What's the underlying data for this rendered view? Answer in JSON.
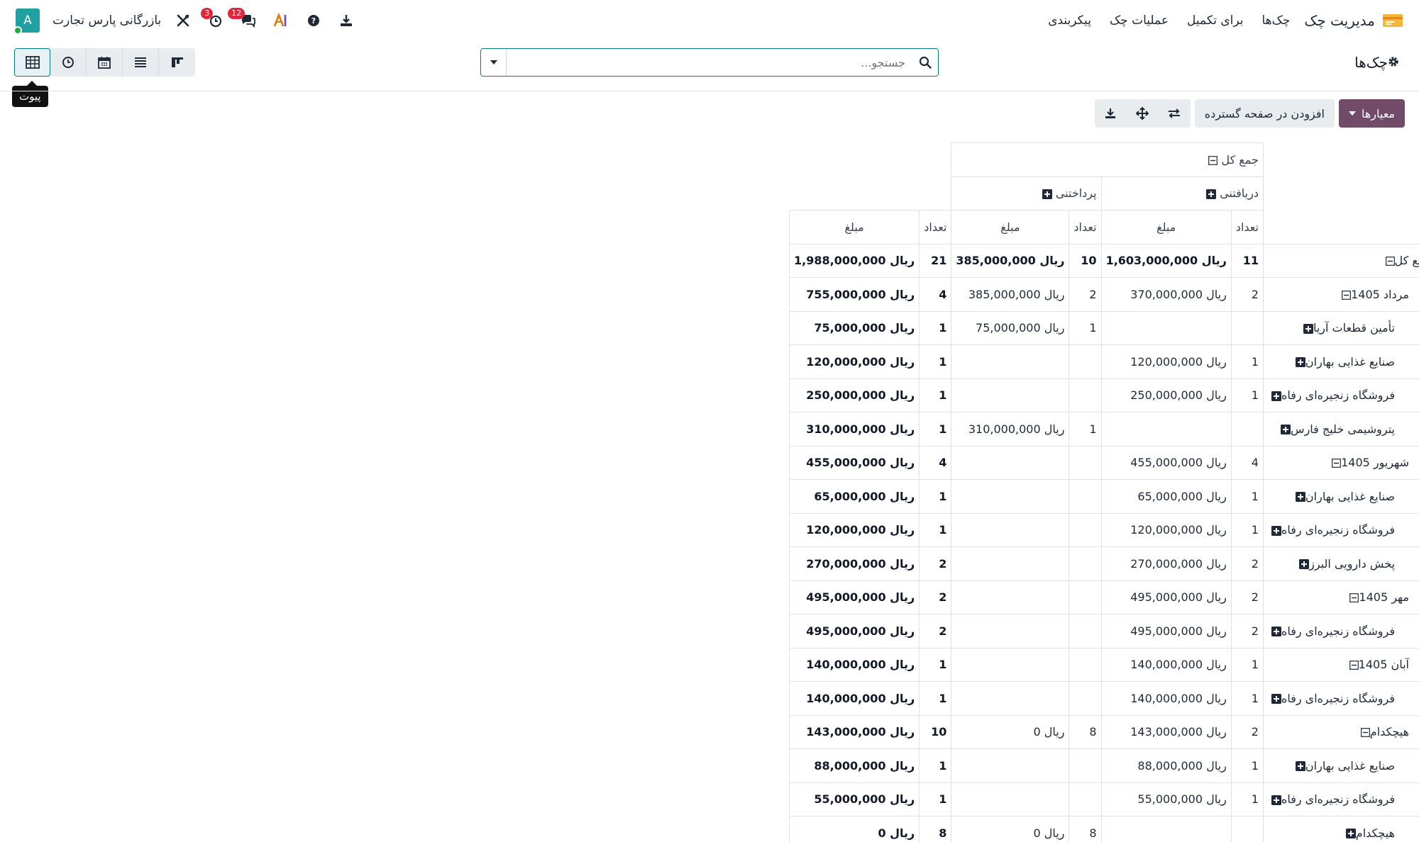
{
  "nav": {
    "app_name": "مدیریت چک",
    "menu": [
      "چک‌ها",
      "برای تکمیل",
      "عملیات چک",
      "پیکربندی"
    ],
    "company": "بازرگانی پارس تجارت",
    "avatar_letter": "A",
    "activity_badge": "3",
    "messages_badge": "12"
  },
  "breadcrumb": {
    "title": "چک‌ها"
  },
  "search": {
    "placeholder": "جستجو..."
  },
  "tooltip": "پیوت",
  "actions": {
    "measures": "معیارها",
    "insert_spreadsheet": "افزودن در صفحه گسترده"
  },
  "pivot": {
    "col_total": "جمع کل",
    "groups": [
      "دریافتنی",
      "پرداختنی"
    ],
    "measure_count": "تعداد",
    "measure_amount": "مبلغ",
    "rows": [
      {
        "label": "جمع کل",
        "level": 0,
        "icon": "minus",
        "rc": "11",
        "ra": "1,603,000,000 ریال",
        "pc": "10",
        "pa": "385,000,000 ریال",
        "tc": "21",
        "ta": "1,988,000,000 ریال"
      },
      {
        "label": "مرداد 1405",
        "level": 1,
        "icon": "minus",
        "rc": "2",
        "ra": "370,000,000 ریال",
        "pc": "2",
        "pa": "385,000,000 ریال",
        "tc": "4",
        "ta": "755,000,000 ریال"
      },
      {
        "label": "تأمین قطعات آریا",
        "level": 2,
        "icon": "plus",
        "rc": "",
        "ra": "",
        "pc": "1",
        "pa": "75,000,000 ریال",
        "tc": "1",
        "ta": "75,000,000 ریال"
      },
      {
        "label": "صنایع غذایی بهاران",
        "level": 2,
        "icon": "plus",
        "rc": "1",
        "ra": "120,000,000 ریال",
        "pc": "",
        "pa": "",
        "tc": "1",
        "ta": "120,000,000 ریال"
      },
      {
        "label": "فروشگاه زنجیره‌ای رفاه",
        "level": 2,
        "icon": "plus",
        "rc": "1",
        "ra": "250,000,000 ریال",
        "pc": "",
        "pa": "",
        "tc": "1",
        "ta": "250,000,000 ریال"
      },
      {
        "label": "پتروشیمی خلیج فارس",
        "level": 2,
        "icon": "plus",
        "rc": "",
        "ra": "",
        "pc": "1",
        "pa": "310,000,000 ریال",
        "tc": "1",
        "ta": "310,000,000 ریال"
      },
      {
        "label": "شهریور 1405",
        "level": 1,
        "icon": "minus",
        "rc": "4",
        "ra": "455,000,000 ریال",
        "pc": "",
        "pa": "",
        "tc": "4",
        "ta": "455,000,000 ریال"
      },
      {
        "label": "صنایع غذایی بهاران",
        "level": 2,
        "icon": "plus",
        "rc": "1",
        "ra": "65,000,000 ریال",
        "pc": "",
        "pa": "",
        "tc": "1",
        "ta": "65,000,000 ریال"
      },
      {
        "label": "فروشگاه زنجیره‌ای رفاه",
        "level": 2,
        "icon": "plus",
        "rc": "1",
        "ra": "120,000,000 ریال",
        "pc": "",
        "pa": "",
        "tc": "1",
        "ta": "120,000,000 ریال"
      },
      {
        "label": "پخش دارویی البرز",
        "level": 2,
        "icon": "plus",
        "rc": "2",
        "ra": "270,000,000 ریال",
        "pc": "",
        "pa": "",
        "tc": "2",
        "ta": "270,000,000 ریال"
      },
      {
        "label": "مهر 1405",
        "level": 1,
        "icon": "minus",
        "rc": "2",
        "ra": "495,000,000 ریال",
        "pc": "",
        "pa": "",
        "tc": "2",
        "ta": "495,000,000 ریال"
      },
      {
        "label": "فروشگاه زنجیره‌ای رفاه",
        "level": 2,
        "icon": "plus",
        "rc": "2",
        "ra": "495,000,000 ریال",
        "pc": "",
        "pa": "",
        "tc": "2",
        "ta": "495,000,000 ریال"
      },
      {
        "label": "آبان 1405",
        "level": 1,
        "icon": "minus",
        "rc": "1",
        "ra": "140,000,000 ریال",
        "pc": "",
        "pa": "",
        "tc": "1",
        "ta": "140,000,000 ریال"
      },
      {
        "label": "فروشگاه زنجیره‌ای رفاه",
        "level": 2,
        "icon": "plus",
        "rc": "1",
        "ra": "140,000,000 ریال",
        "pc": "",
        "pa": "",
        "tc": "1",
        "ta": "140,000,000 ریال"
      },
      {
        "label": "هیچکدام",
        "level": 1,
        "icon": "minus",
        "rc": "2",
        "ra": "143,000,000 ریال",
        "pc": "8",
        "pa": "0 ریال",
        "tc": "10",
        "ta": "143,000,000 ریال"
      },
      {
        "label": "صنایع غذایی بهاران",
        "level": 2,
        "icon": "plus",
        "rc": "1",
        "ra": "88,000,000 ریال",
        "pc": "",
        "pa": "",
        "tc": "1",
        "ta": "88,000,000 ریال"
      },
      {
        "label": "فروشگاه زنجیره‌ای رفاه",
        "level": 2,
        "icon": "plus",
        "rc": "1",
        "ra": "55,000,000 ریال",
        "pc": "",
        "pa": "",
        "tc": "1",
        "ta": "55,000,000 ریال"
      },
      {
        "label": "هیچکدام",
        "level": 2,
        "icon": "plus",
        "rc": "",
        "ra": "",
        "pc": "8",
        "pa": "0 ریال",
        "tc": "8",
        "ta": "0 ریال"
      }
    ]
  },
  "colors": {
    "primary": "#714b67",
    "accent": "#017e84",
    "badge": "#e0263c"
  }
}
